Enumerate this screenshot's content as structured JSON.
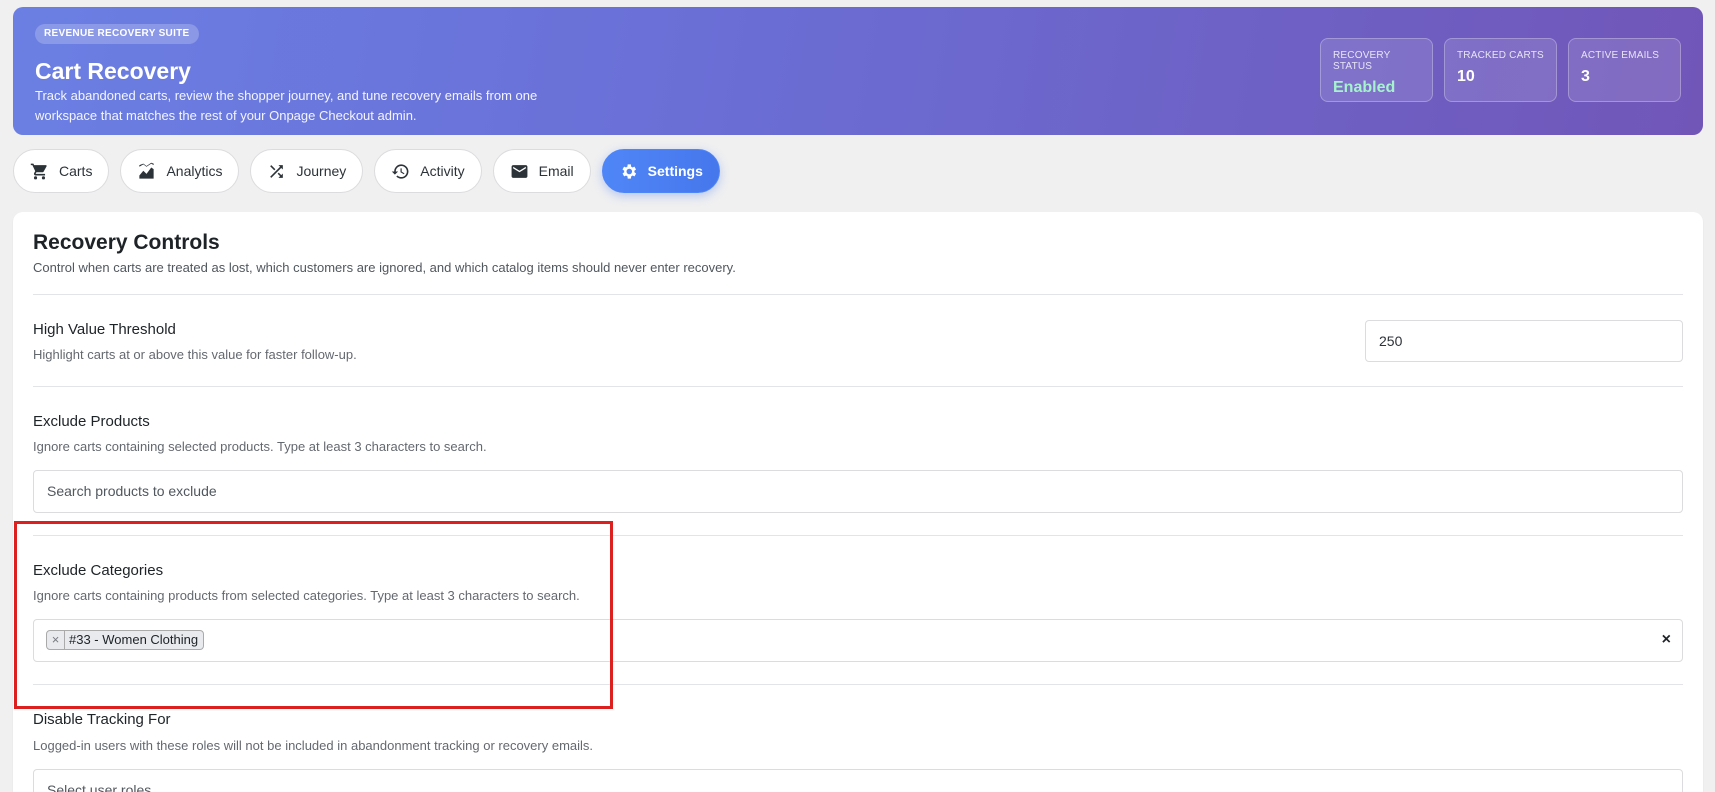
{
  "hero": {
    "badge": "REVENUE RECOVERY SUITE",
    "title": "Cart Recovery",
    "description": "Track abandoned carts, review the shopper journey, and tune recovery emails from one workspace that matches the rest of your Onpage Checkout admin.",
    "stats": [
      {
        "label": "RECOVERY STATUS",
        "value": "Enabled"
      },
      {
        "label": "TRACKED CARTS",
        "value": "10"
      },
      {
        "label": "ACTIVE EMAILS",
        "value": "3"
      }
    ]
  },
  "tabs": [
    {
      "label": "Carts",
      "icon": "cart-icon"
    },
    {
      "label": "Analytics",
      "icon": "chart-icon"
    },
    {
      "label": "Journey",
      "icon": "shuffle-icon"
    },
    {
      "label": "Activity",
      "icon": "history-icon"
    },
    {
      "label": "Email",
      "icon": "envelope-icon"
    },
    {
      "label": "Settings",
      "icon": "gear-icon",
      "active": true
    }
  ],
  "settings": {
    "title": "Recovery Controls",
    "description": "Control when carts are treated as lost, which customers are ignored, and which catalog items should never enter recovery.",
    "high_value": {
      "label": "High Value Threshold",
      "help": "Highlight carts at or above this value for faster follow-up.",
      "value": "250"
    },
    "exclude_products": {
      "label": "Exclude Products",
      "help": "Ignore carts containing selected products. Type at least 3 characters to search.",
      "placeholder": "Search products to exclude"
    },
    "exclude_categories": {
      "label": "Exclude Categories",
      "help": "Ignore carts containing products from selected categories. Type at least 3 characters to search.",
      "tags": [
        "#33 - Women Clothing"
      ],
      "tag_remove": "×",
      "clear": "×"
    },
    "disable_tracking": {
      "label": "Disable Tracking For",
      "help": "Logged-in users with these roles will not be included in abandonment tracking or recovery emails.",
      "placeholder": "Select user roles"
    }
  },
  "colors": {
    "accent": "#4f86f7",
    "enabled_status": "#a6f2cf",
    "highlight": "#dc1f1f"
  }
}
